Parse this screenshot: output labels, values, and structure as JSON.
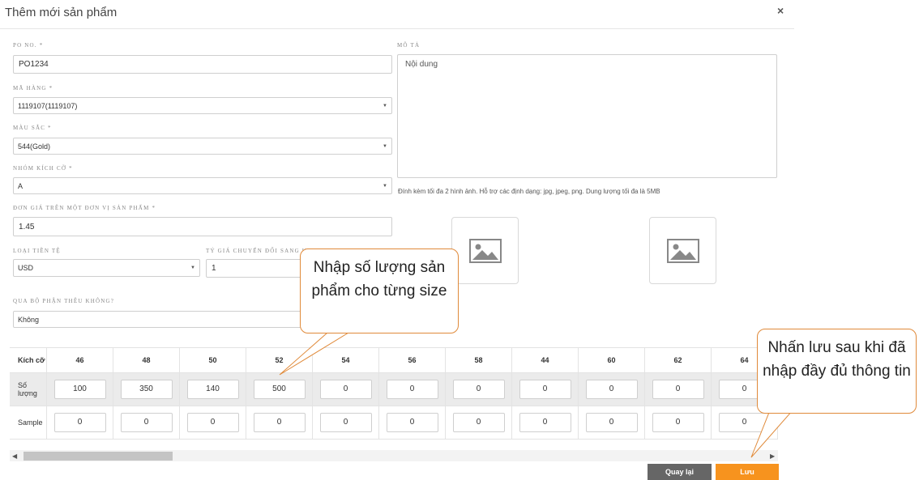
{
  "dialog": {
    "title": "Thêm mới sản phẩm",
    "close": "×"
  },
  "form": {
    "po_label": "PO NO. *",
    "po_value": "PO1234",
    "ma_hang_label": "MÃ HÀNG *",
    "ma_hang_value": "1119107(1119107)",
    "mau_sac_label": "MÀU SẮC *",
    "mau_sac_value": "544(Gold)",
    "nhom_label": "NHÓM KÍCH CỠ *",
    "nhom_value": "A",
    "don_gia_label": "ĐƠN GIÁ TRÊN MỘT ĐƠN VỊ SẢN PHẨM *",
    "don_gia_value": "1.45",
    "tien_te_label": "LOẠI TIỀN TỆ",
    "tien_te_value": "USD",
    "ty_gia_label": "TỶ GIÁ CHUYỂN ĐỔI SANG U",
    "ty_gia_value": "1",
    "theu_label": "QUA BỘ PHẬN THÊU KHÔNG?",
    "theu_value": "Không",
    "mo_ta_label": "MÔ TẢ",
    "mo_ta_value": "Nội dung",
    "attach_hint": "Đính kèm tối đa 2 hình ảnh. Hỗ trợ các định dạng: jpg, jpeg, png. Dung lượng tối đa là 5MB"
  },
  "size_table": {
    "header_label": "Kích cỡ",
    "qty_label": "Số lượng",
    "sample_label": "Sample",
    "sizes": [
      "46",
      "48",
      "50",
      "52",
      "54",
      "56",
      "58",
      "44",
      "60",
      "62",
      "64"
    ],
    "quantities": [
      "100",
      "350",
      "140",
      "500",
      "0",
      "0",
      "0",
      "0",
      "0",
      "0",
      "0"
    ],
    "samples": [
      "0",
      "0",
      "0",
      "0",
      "0",
      "0",
      "0",
      "0",
      "0",
      "0",
      "0"
    ]
  },
  "buttons": {
    "back": "Quay lại",
    "save": "Lưu",
    "back_color": "#666666",
    "save_color": "#f7931e"
  },
  "callouts": {
    "qty_note": "Nhập số lượng sản phẩm cho từng size",
    "save_note": "Nhấn lưu sau khi đã nhập đầy đủ thông tin"
  },
  "icons": {
    "image_placeholder": "image-icon",
    "caret": "▼",
    "scroll_left": "◀",
    "scroll_right": "▶"
  }
}
